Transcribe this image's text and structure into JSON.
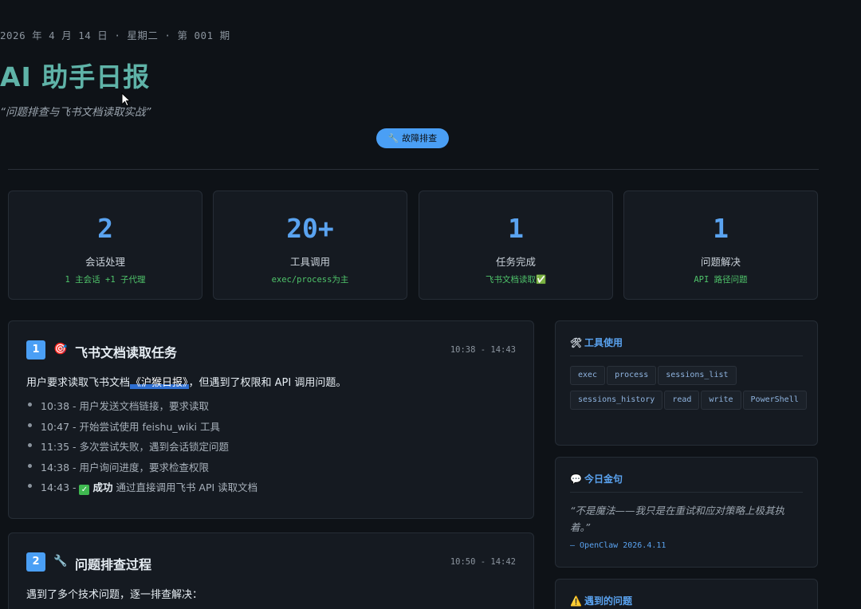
{
  "header": {
    "date": "2026 年 4 月 14 日 · 星期二 · 第 001 期",
    "title": "AI 助手日报",
    "subtitle": "“问题排查与飞书文档读取实战”",
    "tag": "🔧 故障排查"
  },
  "stats": [
    {
      "value": "2",
      "label": "会话处理",
      "sub": "1 主会话 +1 子代理"
    },
    {
      "value": "20+",
      "label": "工具调用",
      "sub": "exec/process为主"
    },
    {
      "value": "1",
      "label": "任务完成",
      "sub": "飞书文档读取✅"
    },
    {
      "value": "1",
      "label": "问题解决",
      "sub": "API 路径问题"
    }
  ],
  "sessions": [
    {
      "index": "1",
      "icon": "🎯",
      "title": "飞书文档读取任务",
      "time": "10:38 - 14:43",
      "desc_before": "用户要求读取飞书文档",
      "desc_link": "《沪猴日报》",
      "desc_after": "，但遇到了权限和 API 调用问题。",
      "events": [
        "10:38 - 用户发送文档链接，要求读取",
        "10:47 - 开始尝试使用 feishu_wiki 工具",
        "11:35 - 多次尝试失败，遇到会话锁定问题",
        "14:38 - 用户询问进度，要求检查权限"
      ],
      "last_event": {
        "time": "14:43 - ",
        "check": "✓",
        "strong": "成功",
        "rest": " 通过直接调用飞书 API 读取文档"
      }
    },
    {
      "index": "2",
      "icon": "🔧",
      "title": "问题排查过程",
      "time": "10:50 - 14:42",
      "desc": "遇到了多个技术问题，逐一排查解决："
    }
  ],
  "panels": {
    "tools": {
      "icon": "🛠",
      "title": "工具使用",
      "chips": [
        "exec",
        "process",
        "sessions_list",
        "sessions_history",
        "read",
        "write",
        "PowerShell"
      ]
    },
    "quote": {
      "icon": "💬",
      "title": "今日金句",
      "text": "“不是魔法——我只是在重试和应对策略上极其执着。”",
      "source": "— OpenClaw 2026.4.11"
    },
    "issues": {
      "icon": "⚠️",
      "title": "遇到的问题"
    }
  }
}
